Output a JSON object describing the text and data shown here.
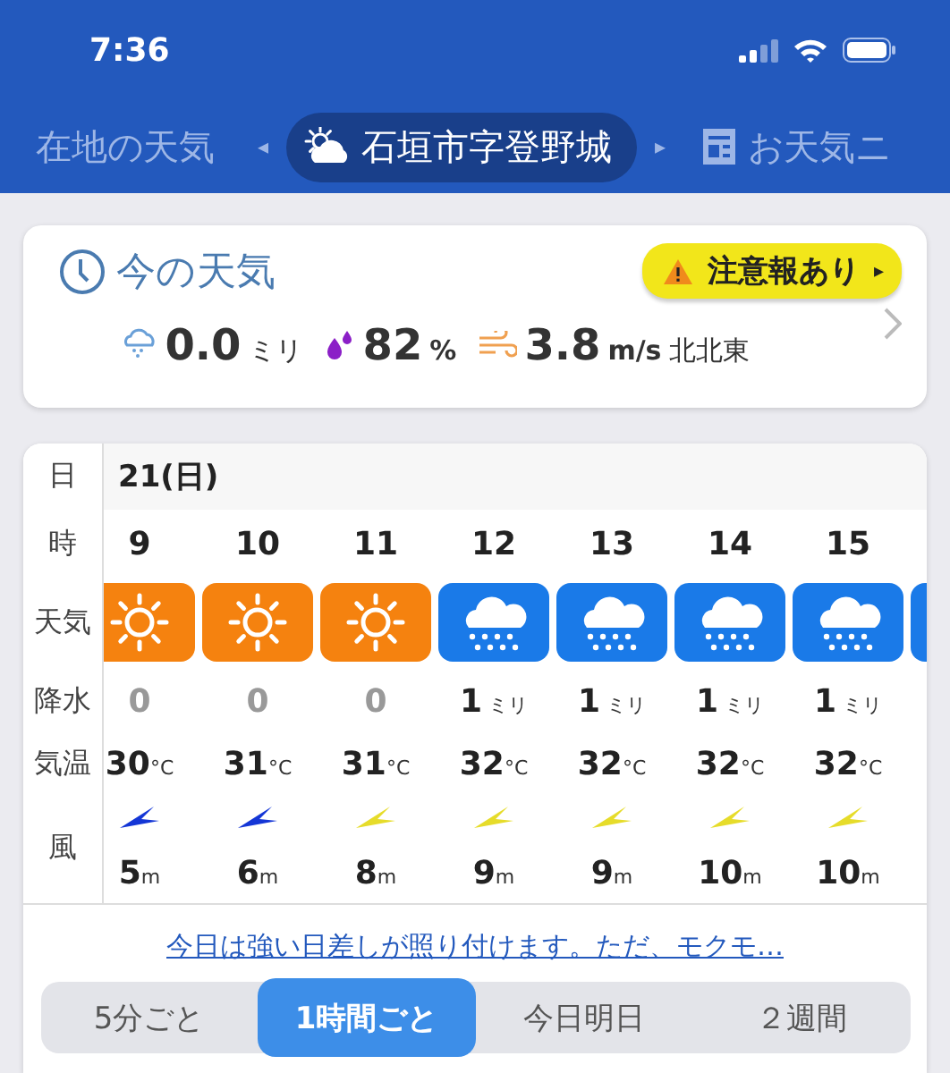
{
  "status_bar": {
    "time": "7:36"
  },
  "locations": [
    {
      "label": "在地の天気",
      "kind": "plain",
      "selected": false
    },
    {
      "label": "石垣市字登野城",
      "kind": "place",
      "selected": true
    },
    {
      "label": "お天気ニ",
      "kind": "news",
      "selected": false
    }
  ],
  "location_arrows": {
    "prev": "◂",
    "next": "▸"
  },
  "current": {
    "title": "今の天気",
    "alert": "注意報あり",
    "alert_arrow": "▸",
    "rain": {
      "value": "0.0",
      "unit": "ミリ"
    },
    "humidity": {
      "value": "82",
      "unit": "%"
    },
    "wind": {
      "value": "3.8",
      "unit": "m/s",
      "direction": "北北東"
    }
  },
  "forecast": {
    "row_labels": {
      "day": "日",
      "hour": "時",
      "weather": "天気",
      "precip": "降水",
      "temp": "気温",
      "wind": "風"
    },
    "day": "21(日)",
    "hours": [
      {
        "hour": "9",
        "kind": "sunny",
        "precip": "0",
        "dry": true,
        "temp": "30",
        "temp_unit": "°C",
        "color": "#1436d6",
        "wind_speed": "5",
        "wind_unit": "m"
      },
      {
        "hour": "10",
        "kind": "sunny",
        "precip": "0",
        "dry": true,
        "temp": "31",
        "temp_unit": "°C",
        "color": "#1436d6",
        "wind_speed": "6",
        "wind_unit": "m"
      },
      {
        "hour": "11",
        "kind": "sunny",
        "precip": "0",
        "dry": true,
        "temp": "31",
        "temp_unit": "°C",
        "color": "#e6dc2a",
        "wind_speed": "8",
        "wind_unit": "m"
      },
      {
        "hour": "12",
        "kind": "rain",
        "precip": "1",
        "precip_unit": "ミリ",
        "dry": false,
        "temp": "32",
        "temp_unit": "°C",
        "color": "#e6dc2a",
        "wind_speed": "9",
        "wind_unit": "m"
      },
      {
        "hour": "13",
        "kind": "rain",
        "precip": "1",
        "precip_unit": "ミリ",
        "dry": false,
        "temp": "32",
        "temp_unit": "°C",
        "color": "#e6dc2a",
        "wind_speed": "9",
        "wind_unit": "m"
      },
      {
        "hour": "14",
        "kind": "rain",
        "precip": "1",
        "precip_unit": "ミリ",
        "dry": false,
        "temp": "32",
        "temp_unit": "°C",
        "color": "#e6dc2a",
        "wind_speed": "10",
        "wind_unit": "m"
      },
      {
        "hour": "15",
        "kind": "rain",
        "precip": "1",
        "precip_unit": "ミリ",
        "dry": false,
        "temp": "32",
        "temp_unit": "°C",
        "color": "#e6dc2a",
        "wind_speed": "10",
        "wind_unit": "m"
      },
      {
        "kind": "rain"
      }
    ],
    "summary_link": "今日は強い日差しが照り付けます。ただ、モクモ…"
  },
  "view_tabs": [
    {
      "label": "5分ごと",
      "selected": false
    },
    {
      "label": "1時間ごと",
      "selected": true
    },
    {
      "label": "今日明日",
      "selected": false
    },
    {
      "label": "２週間",
      "selected": false
    }
  ]
}
